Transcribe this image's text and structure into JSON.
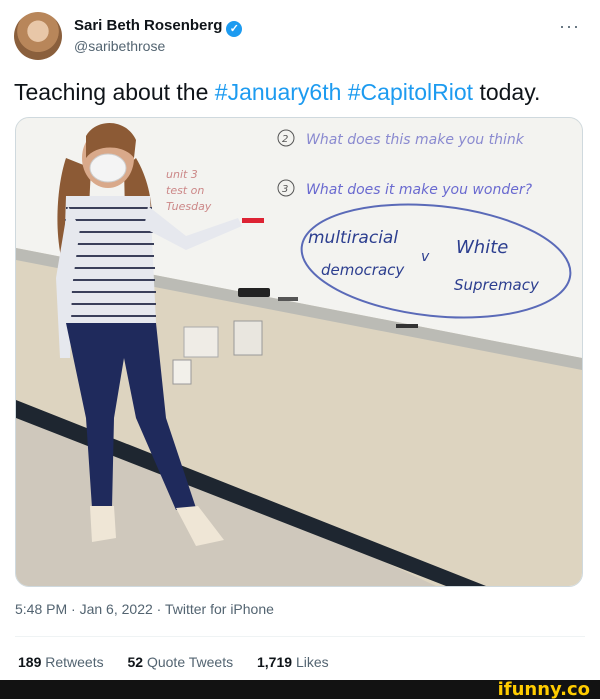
{
  "author": {
    "name": "Sari Beth Rosenberg",
    "handle": "@saribethrose",
    "verified_glyph": "✓"
  },
  "menu": {
    "more_glyph": "···"
  },
  "tweet": {
    "text_pre": "Teaching about the ",
    "hashtag1": "#January6th",
    "space": " ",
    "hashtag2": "#CapitolRiot",
    "text_post": " today."
  },
  "photo": {
    "whiteboard": {
      "q2": "What does this make you think",
      "q3": "What does it make you wonder?",
      "left_note_1": "unit 3",
      "left_note_2": "test on",
      "left_note_3": "Tuesday",
      "left_term_1": "multiracial",
      "left_term_2": "democracy",
      "vs": "v",
      "right_term_1": "White",
      "right_term_2": "Supremacy",
      "num2": "2",
      "num3": "3"
    }
  },
  "meta": {
    "time": "5:48 PM",
    "sep1": " · ",
    "date": "Jan 6, 2022",
    "sep2": " · ",
    "source": "Twitter for iPhone"
  },
  "stats": {
    "retweets_count": "189",
    "retweets_label": "Retweets",
    "quotes_count": "52",
    "quotes_label": "Quote Tweets",
    "likes_count": "1,719",
    "likes_label": "Likes"
  },
  "footer": {
    "brand": "ifunny.co"
  },
  "colors": {
    "accent": "#1d9bf0",
    "text": "#0f1419",
    "muted": "#536471",
    "brand": "#ffcc00"
  }
}
